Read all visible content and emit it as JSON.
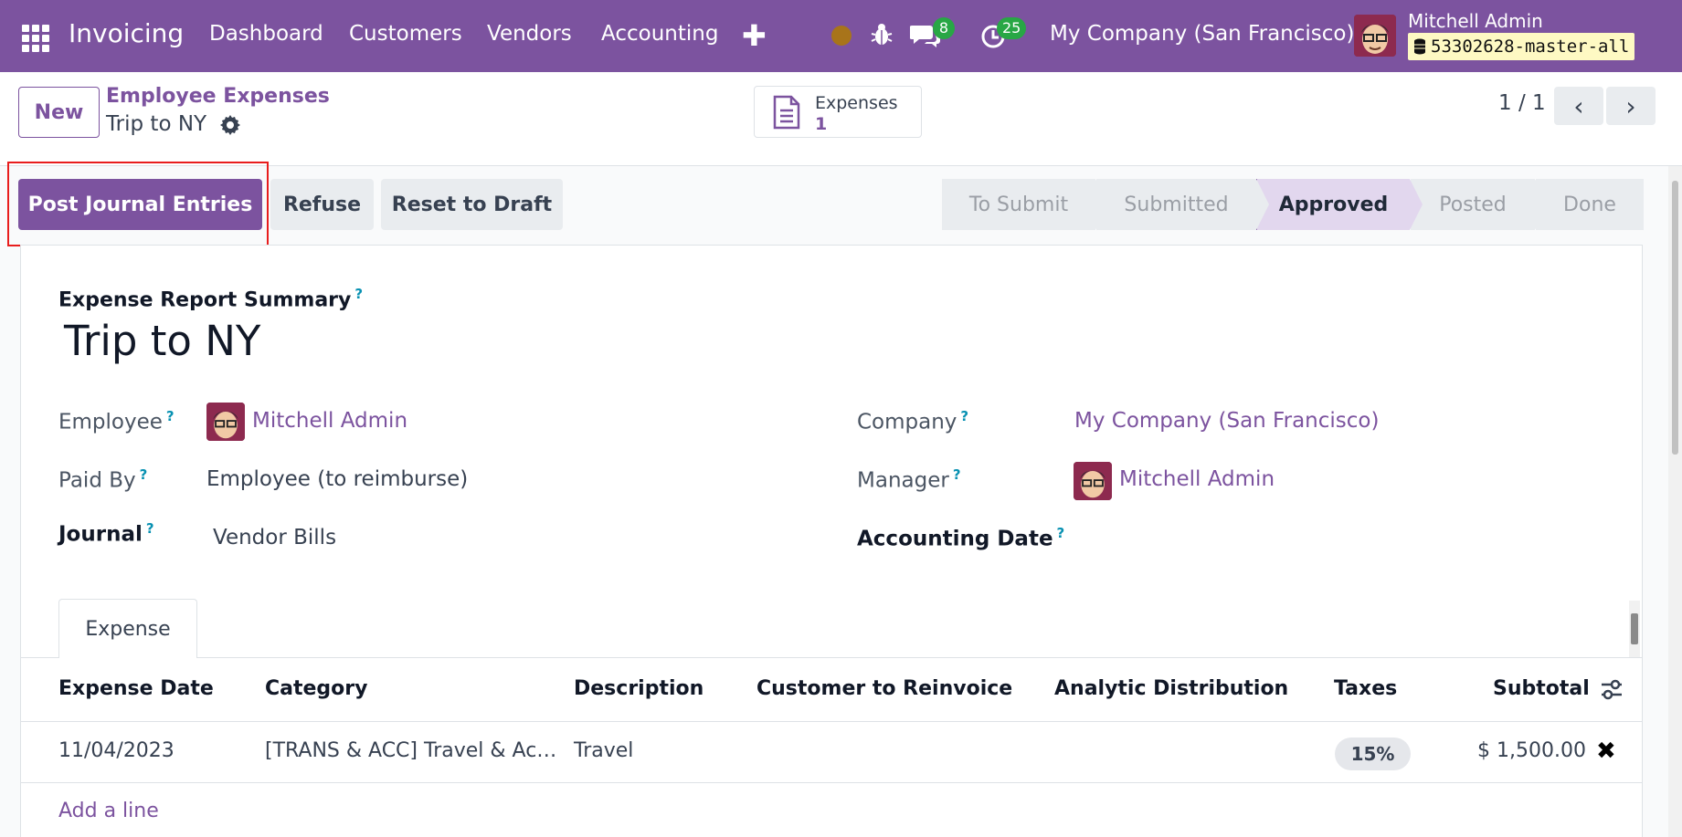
{
  "navbar": {
    "app_name": "Invoicing",
    "menus": [
      "Dashboard",
      "Customers",
      "Vendors",
      "Accounting"
    ],
    "messages_count": "8",
    "activities_count": "25",
    "company": "My Company (San Francisco)",
    "user_name": "Mitchell Admin",
    "database": "53302628-master-all"
  },
  "breadcrumb": {
    "parent": "Employee Expenses",
    "current": "Trip to NY"
  },
  "buttons": {
    "new": "New",
    "post": "Post Journal Entries",
    "refuse": "Refuse",
    "reset": "Reset to Draft"
  },
  "smart_button": {
    "label": "Expenses",
    "count": "1"
  },
  "pager": {
    "value": "1 / 1"
  },
  "statusbar": {
    "stages": [
      "To Submit",
      "Submitted",
      "Approved",
      "Posted",
      "Done"
    ],
    "current": "Approved"
  },
  "form": {
    "summary_label": "Expense Report Summary",
    "title": "Trip to NY",
    "employee_label": "Employee",
    "employee": "Mitchell Admin",
    "paid_by_label": "Paid By",
    "paid_by": "Employee (to reimburse)",
    "journal_label": "Journal",
    "journal": "Vendor Bills",
    "company_label": "Company",
    "company": "My Company (San Francisco)",
    "manager_label": "Manager",
    "manager": "Mitchell Admin",
    "accounting_date_label": "Accounting Date",
    "help_mark": "?"
  },
  "tabs": {
    "expense": "Expense"
  },
  "table": {
    "headers": [
      "Expense Date",
      "Category",
      "Description",
      "Customer to Reinvoice",
      "Analytic Distribution",
      "Taxes",
      "Subtotal"
    ],
    "rows": [
      {
        "date": "11/04/2023",
        "category": "[TRANS & ACC] Travel & Ac…",
        "description": "Travel",
        "customer": "",
        "analytic": "",
        "taxes": "15%",
        "subtotal": "$ 1,500.00"
      }
    ],
    "add_line": "Add a line"
  },
  "colors": {
    "brand": "#7c539f",
    "highlight": "#e81d1d",
    "badge": "#28a745"
  }
}
